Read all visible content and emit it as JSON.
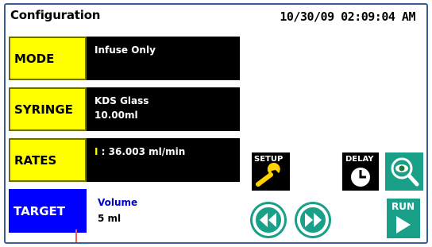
{
  "header": {
    "title": "Configuration",
    "datetime": "10/30/09 02:09:04 AM"
  },
  "rows": {
    "mode": {
      "label": "MODE",
      "value": "Infuse Only"
    },
    "syringe": {
      "label": "SYRINGE",
      "line1": "KDS Glass",
      "line2": "10.00ml"
    },
    "rates": {
      "label": "RATES",
      "prefix": "I",
      "value": " : 36.003 ml/min"
    },
    "target": {
      "label": "TARGET",
      "line1": "Volume",
      "line2": "5 ml"
    }
  },
  "buttons": {
    "setup": "SETUP",
    "delay": "DELAY",
    "run": "RUN"
  },
  "colors": {
    "label_bg": "#ffff00",
    "row_bg": "#000000",
    "target_bg": "#0000ff",
    "button_teal": "#1aa089",
    "border": "#3a5f95"
  },
  "icons": [
    "wrench-icon",
    "clock-icon",
    "eye-magnifier-icon",
    "rewind-icon",
    "fast-forward-icon",
    "play-icon"
  ]
}
